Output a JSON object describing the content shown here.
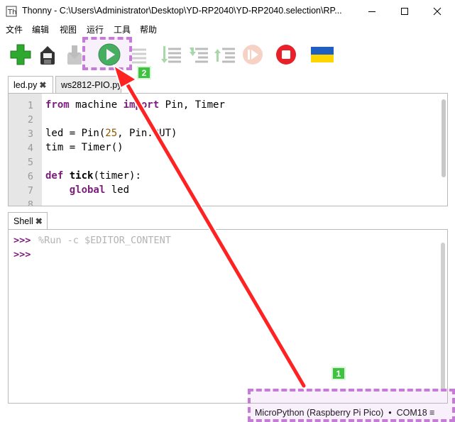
{
  "window": {
    "title": "Thonny  -  C:\\Users\\Administrator\\Desktop\\YD-RP2040\\YD-RP2040.selection\\RP..."
  },
  "menu": [
    "文件",
    "编辑",
    "视图",
    "运行",
    "工具",
    "帮助"
  ],
  "toolbar": {
    "icons": [
      "new-file-icon",
      "save-icon",
      "download-icon",
      "run-icon",
      "debug-icon",
      "step-over-icon",
      "step-into-icon",
      "step-out-icon",
      "resume-icon",
      "stop-icon",
      "ukraine-flag-icon"
    ]
  },
  "editor": {
    "tabs": [
      {
        "label": "led.py",
        "close": "✖"
      },
      {
        "label": "ws2812-PIO.py",
        "close": ""
      }
    ],
    "line_numbers": [
      "1",
      "2",
      "3",
      "4",
      "5",
      "6",
      "7"
    ],
    "lines": [
      "from machine import Pin, Timer",
      "",
      "led = Pin(25, Pin.OUT)",
      "tim = Timer()",
      "",
      "def tick(timer):",
      "    global led"
    ]
  },
  "shell": {
    "tab_label": "Shell",
    "tab_close": "✖",
    "prompt": ">>>",
    "command": "%Run -c $EDITOR_CONTENT"
  },
  "status": {
    "interpreter": "MicroPython (Raspberry Pi Pico)",
    "separator": "•",
    "port": "COM18",
    "menu_icon": "≡"
  },
  "annotations": {
    "badge_run": "2",
    "badge_status": "1",
    "highlight_color": "#c77bd9",
    "arrow_color": "#ff2222",
    "badge_color": "#3fc23f"
  }
}
